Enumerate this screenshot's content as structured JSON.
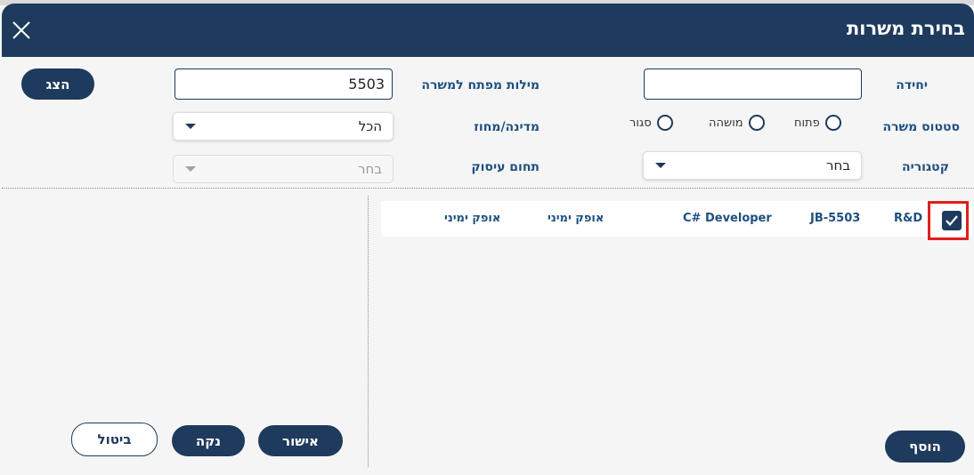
{
  "dialog": {
    "title": "בחירת משרות"
  },
  "filters": {
    "unit_label": "יחידה",
    "unit_value": "",
    "keywords_label": "מילות מפתח למשרה",
    "keywords_value": "5503",
    "status_label": "סטטוס משרה",
    "status_options": [
      "פתוח",
      "מושהה",
      "סגור"
    ],
    "country_label": "מדינה/מחוז",
    "country_value": "הכל",
    "category_label": "קטגוריה",
    "category_value": "בחר",
    "field_label": "תחום עיסוק",
    "field_value": "בחר"
  },
  "buttons": {
    "show": "הצג",
    "add": "הוסף",
    "confirm": "אישור",
    "clear": "נקה",
    "cancel": "ביטול"
  },
  "results": [
    {
      "selected": true,
      "unit": "R&D",
      "job_id": "JB-5503",
      "title": "C# Developer",
      "col4": "אופק ימיני",
      "col5": "אופק ימיני"
    }
  ],
  "colors": {
    "header": "#1e3a5c",
    "label": "#1e4f80",
    "highlight": "#e0201c"
  }
}
